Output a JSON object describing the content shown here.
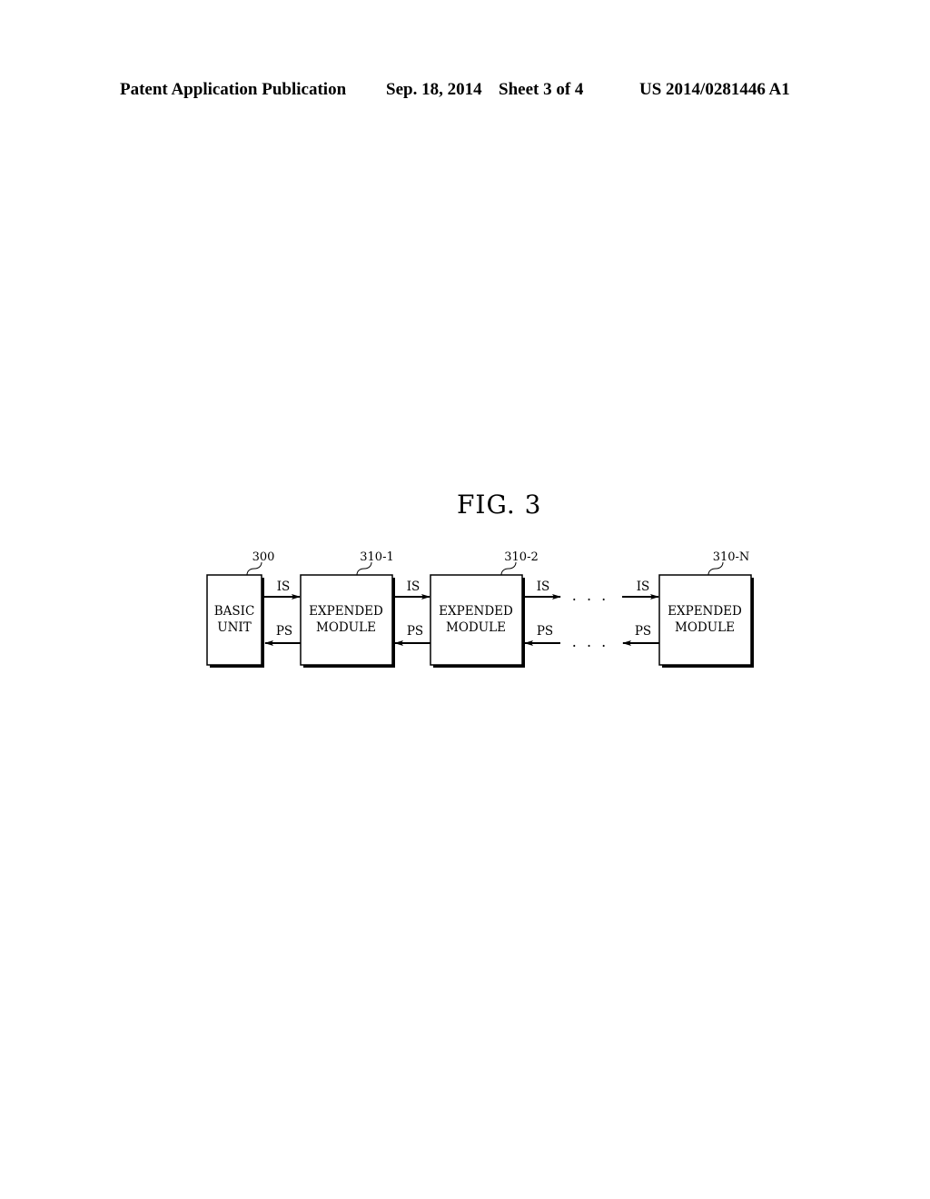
{
  "header": {
    "publication": "Patent Application Publication",
    "date": "Sep. 18, 2014",
    "sheet": "Sheet 3 of 4",
    "patent_number": "US 2014/0281446 A1"
  },
  "figure": {
    "title": "FIG. 3",
    "blocks": [
      {
        "ref": "300",
        "line1": "BASIC",
        "line2": "UNIT"
      },
      {
        "ref": "310-1",
        "line1": "EXPENDED",
        "line2": "MODULE"
      },
      {
        "ref": "310-2",
        "line1": "EXPENDED",
        "line2": "MODULE"
      },
      {
        "ref": "310-N",
        "line1": "EXPENDED",
        "line2": "MODULE"
      }
    ],
    "signals": {
      "forward": "IS",
      "backward": "PS"
    },
    "ellipsis": ". . ."
  }
}
